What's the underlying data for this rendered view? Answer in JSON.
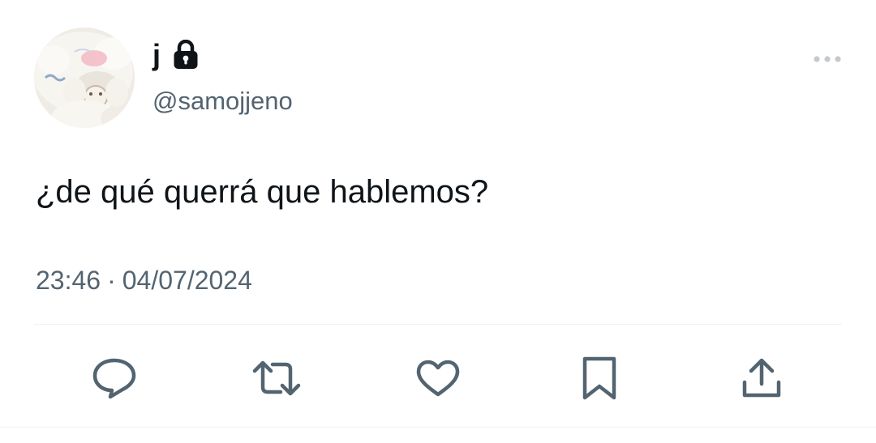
{
  "author": {
    "display_name": "j",
    "handle": "@samojjeno",
    "protected_icon": "lock-icon",
    "avatar": "plush-toy-avatar"
  },
  "tweet": {
    "text": "¿de qué querrá que hablemos?",
    "time": "23:46",
    "separator": "·",
    "date": "04/07/2024"
  },
  "actions": [
    {
      "name": "reply",
      "icon": "reply-icon"
    },
    {
      "name": "retweet",
      "icon": "retweet-icon"
    },
    {
      "name": "like",
      "icon": "heart-icon"
    },
    {
      "name": "bookmark",
      "icon": "bookmark-icon"
    },
    {
      "name": "share",
      "icon": "share-icon"
    }
  ],
  "colors": {
    "text": "#0f1419",
    "secondary": "#536471",
    "divider": "#eff3f4"
  }
}
